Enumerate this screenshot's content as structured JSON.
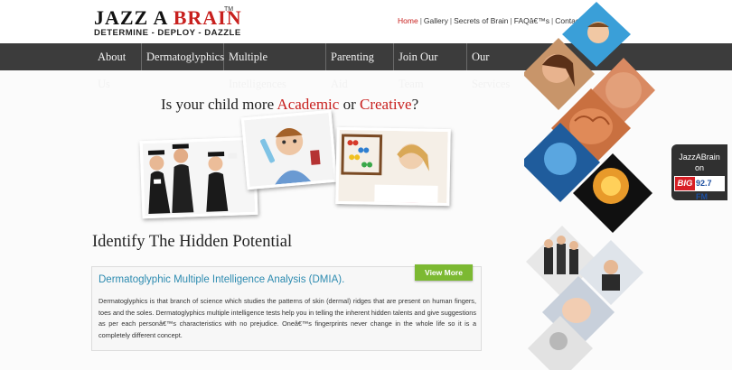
{
  "brand": {
    "name_part1": "JAZZ A ",
    "name_part2": "BRAIN",
    "trademark": "TM",
    "tagline": "DETERMINE - DEPLOY - DAZZLE"
  },
  "top_links": [
    {
      "label": "Home",
      "active": true
    },
    {
      "label": "Gallery",
      "active": false
    },
    {
      "label": "Secrets of Brain",
      "active": false
    },
    {
      "label": "FAQâ€™s",
      "active": false
    },
    {
      "label": "Contact Us",
      "active": false
    }
  ],
  "nav": {
    "items": [
      {
        "label": "About Us"
      },
      {
        "label": "Dermatoglyphics"
      },
      {
        "label": "Multiple Intelligences"
      },
      {
        "label": "Parenting Aid"
      },
      {
        "label": "Join Our Team"
      },
      {
        "label": "Our Services"
      }
    ]
  },
  "hero": {
    "headline_part1": "Is your child more ",
    "headline_academic": "Academic",
    "headline_or": " or ",
    "headline_creative": "Creative",
    "headline_q": "?"
  },
  "section": {
    "title": "Identify The Hidden Potential"
  },
  "dmia": {
    "title": "Dermatoglyphic Multiple Intelligence Analysis (DMIA).",
    "body": "Dermatoglyphics is that branch of science which studies the patterns of skin (dermal) ridges that are present on human fingers, toes and the soles. Dermatoglyphics multiple intelligence tests help you in telling the inherent hidden talents and give suggestions as per each personâ€™s characteristics with no prejudice. Oneâ€™s fingerprints never change in the whole life so it is a completely different concept.",
    "button_label": "View More"
  },
  "radio": {
    "line1": "JazzABrain",
    "line2": "on",
    "logo_big": "BIG",
    "logo_fm": "92.7 FM"
  },
  "colors": {
    "accent_red": "#c8201e",
    "nav_bg": "#3c3c3c",
    "link_blue": "#2d8bb0",
    "button_green": "#7cb932"
  }
}
